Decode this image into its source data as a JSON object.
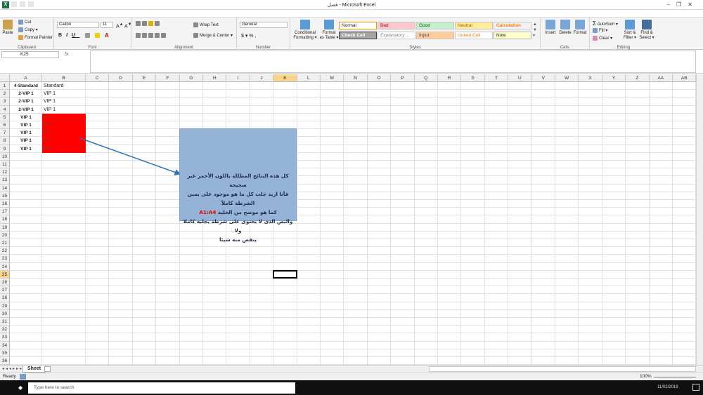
{
  "window": {
    "title": "فصل - Microsoft Excel"
  },
  "ribbon": {
    "clipboard": {
      "label": "Clipboard",
      "paste": "Paste",
      "cut": "Cut",
      "copy": "Copy ▾",
      "format_painter": "Format Painter"
    },
    "font": {
      "label": "Font",
      "name": "Calibri",
      "size": "11"
    },
    "alignment": {
      "label": "Alignment",
      "wrap_text": "Wrap Text",
      "merge_center": "Merge & Center ▾"
    },
    "number": {
      "label": "Number",
      "format": "General",
      "symbols": "$ ▾  %  ,"
    },
    "styles": {
      "label": "Styles",
      "conditional": "Conditional",
      "conditional2": "Formatting ▾",
      "format_table": "Format",
      "format_table2": "as Table ▾",
      "items": [
        {
          "label": "Normal"
        },
        {
          "label": "Bad"
        },
        {
          "label": "Good"
        },
        {
          "label": "Neutral"
        },
        {
          "label": "Calculation"
        },
        {
          "label": "Check Cell"
        },
        {
          "label": "Explanatory ..."
        },
        {
          "label": "Input"
        },
        {
          "label": "Linked Cell"
        },
        {
          "label": "Note"
        }
      ]
    },
    "cells": {
      "label": "Cells",
      "insert": "Insert",
      "delete": "Delete",
      "format": "Format"
    },
    "editing": {
      "label": "Editing",
      "autosum": "AutoSum ▾",
      "fill": "Fill ▾",
      "clear": "Clear ▾",
      "sort": "Sort &",
      "sort2": "Filter ▾",
      "find": "Find &",
      "find2": "Select ▾"
    }
  },
  "formula_bar": {
    "name_box": "K25",
    "fx": "fx",
    "content": ""
  },
  "columns": [
    "A",
    "B",
    "C",
    "D",
    "E",
    "F",
    "G",
    "H",
    "I",
    "J",
    "K",
    "L",
    "M",
    "N",
    "O",
    "P",
    "Q",
    "R",
    "S",
    "T",
    "U",
    "V",
    "W",
    "X",
    "Y",
    "Z",
    "AA",
    "AB"
  ],
  "rows": [
    "1",
    "2",
    "3",
    "4",
    "5",
    "6",
    "7",
    "8",
    "9",
    "10",
    "11",
    "12",
    "13",
    "14",
    "15",
    "16",
    "17",
    "18",
    "19",
    "20",
    "21",
    "22",
    "23",
    "24",
    "25",
    "26",
    "27",
    "28",
    "29",
    "30",
    "31",
    "32",
    "33",
    "34",
    "35",
    "36",
    "37"
  ],
  "cells": {
    "A": [
      "4-Standard",
      "2-VIP 1",
      "2-VIP 1",
      "2-VIP 1",
      "VIP 1",
      "VIP 1",
      "VIP 1",
      "VIP 1",
      "VIP 1"
    ],
    "B": [
      "Standard",
      "VIP 1",
      "VIP 1",
      "VIP 1",
      "P 1",
      "P 1",
      "P 1",
      "P 1",
      "P 1"
    ]
  },
  "callout": {
    "line1": "كل هذه النتائج المظللة باللون الأحمر غير صحيحة",
    "line2": "فأنا اريد جلب كل ما هو موجود على يمين الشرطة كاملاً",
    "line3_pre": "كما هو موضح من الخلية ",
    "line3_ref": "A1:A4",
    "line4": "والنص الذى لا يحتوى على شرطة يجلبه كاملا ولا",
    "line5": "ينقص منه شيئا"
  },
  "sheet_tab": {
    "name": "Sheet"
  },
  "status": {
    "ready": "Ready",
    "zoom": "100%",
    "date": "11/02/2019"
  },
  "taskbar": {
    "search_placeholder": "Type here to search"
  },
  "colors": {
    "red_fill": "#ff0000",
    "callout_bg": "#95b3d7",
    "arrow": "#2e75b6",
    "accent": "#1e7145"
  }
}
